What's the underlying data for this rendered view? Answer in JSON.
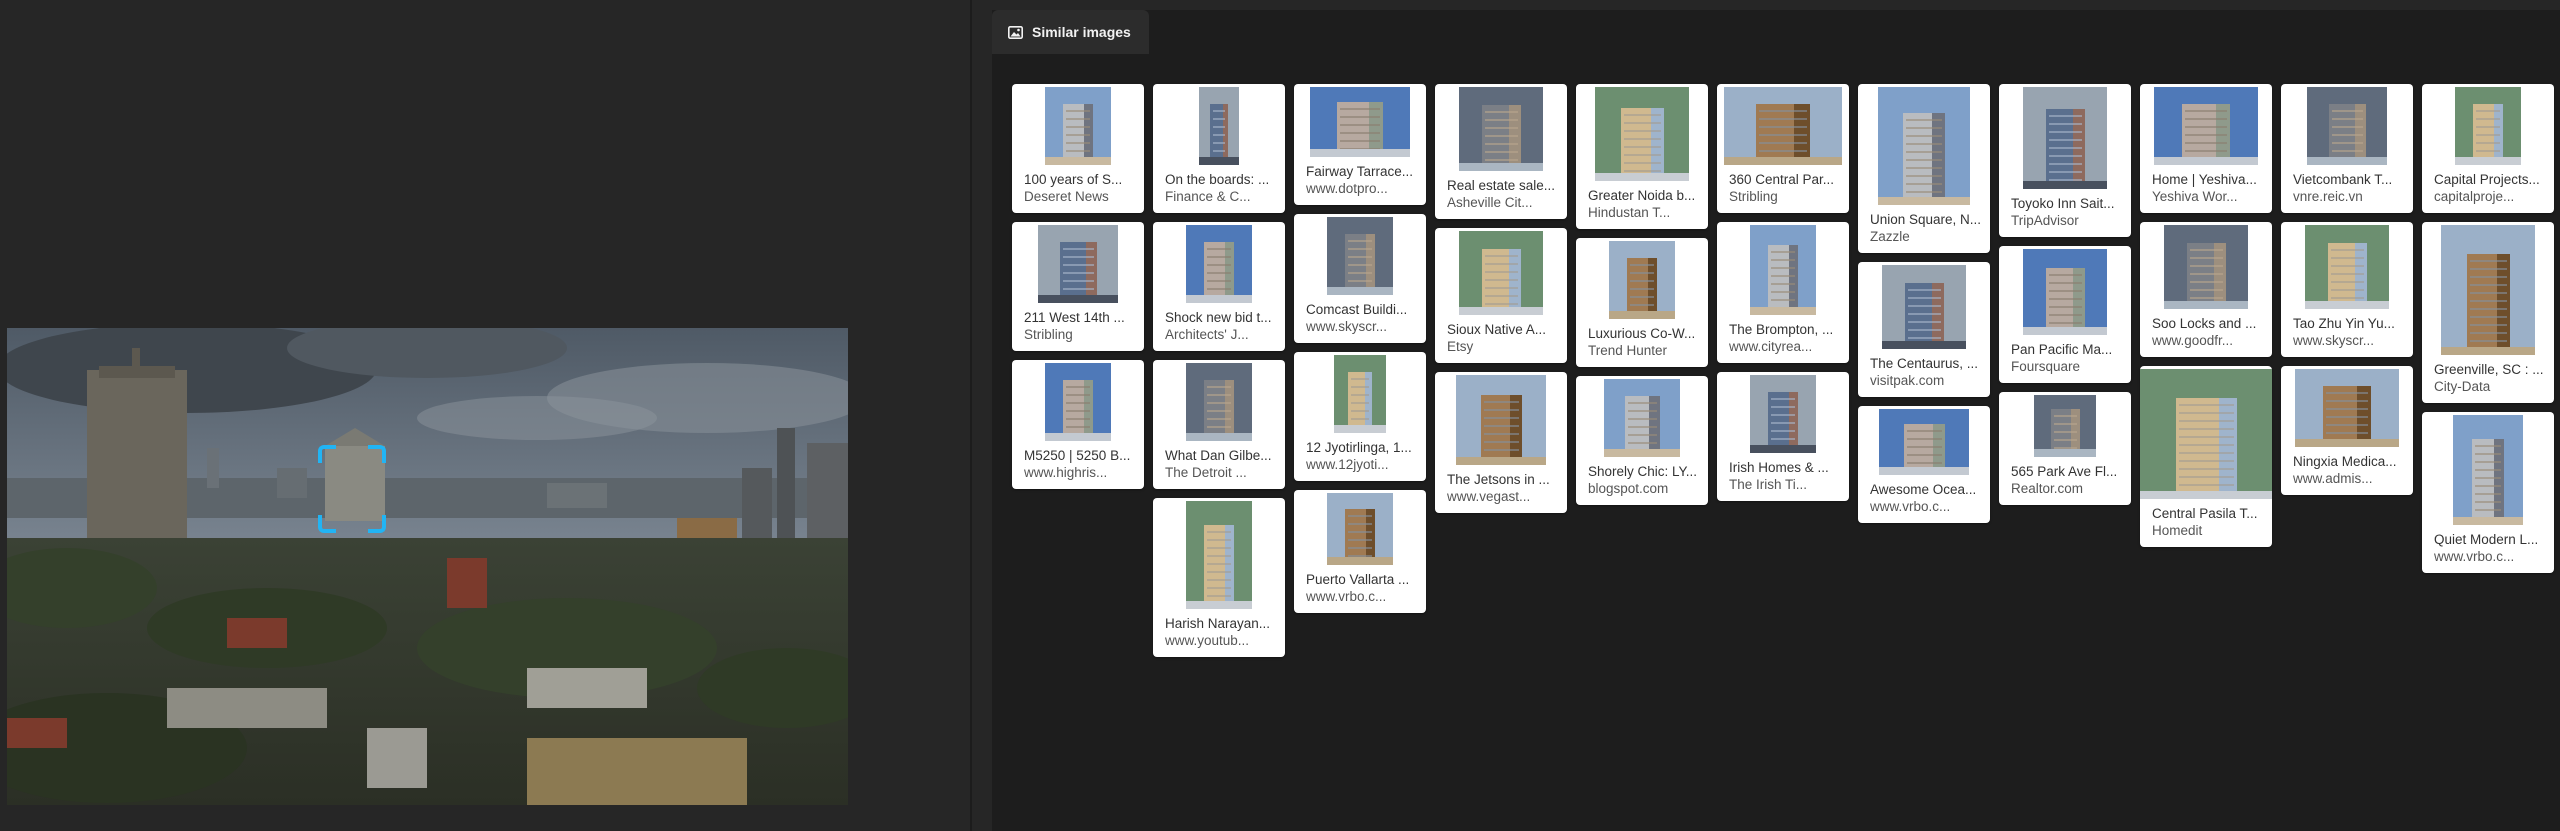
{
  "tabs": [
    {
      "label": "Similar images",
      "icon": "image-icon",
      "active": true
    }
  ],
  "colors": {
    "background": "#262626",
    "panel": "#1d1d1d",
    "crop_accent": "#21b4f4",
    "card": "#ffffff"
  },
  "results": {
    "columns": [
      [
        {
          "title": "100 years of S...",
          "source": "Deseret News"
        },
        {
          "title": "211 West 14th ...",
          "source": "Stribling"
        },
        {
          "title": "M5250 | 5250 B...",
          "source": "www.highris..."
        }
      ],
      [
        {
          "title": "On the boards: ...",
          "source": "Finance & C..."
        },
        {
          "title": "Shock new bid t...",
          "source": "Architects' J..."
        },
        {
          "title": "What Dan Gilbe...",
          "source": "The Detroit ..."
        },
        {
          "title": "Harish Narayan...",
          "source": "www.youtub..."
        }
      ],
      [
        {
          "title": "Fairway Tarrace...",
          "source": "www.dotpro..."
        },
        {
          "title": "Comcast Buildi...",
          "source": "www.skyscr..."
        },
        {
          "title": "12 Jyotirlinga, 1...",
          "source": "www.12jyoti..."
        },
        {
          "title": "Puerto Vallarta ...",
          "source": "www.vrbo.c..."
        }
      ],
      [
        {
          "title": "Real estate sale...",
          "source": "Asheville Cit..."
        },
        {
          "title": "Sioux Native A...",
          "source": "Etsy"
        },
        {
          "title": "The Jetsons in ...",
          "source": "www.vegast..."
        }
      ],
      [
        {
          "title": "Greater Noida b...",
          "source": "Hindustan T..."
        },
        {
          "title": "Luxurious Co-W...",
          "source": "Trend Hunter"
        },
        {
          "title": "Shorely Chic: LY...",
          "source": "blogspot.com"
        }
      ],
      [
        {
          "title": "360 Central Par...",
          "source": "Stribling"
        },
        {
          "title": "The Brompton, ...",
          "source": "www.cityrea..."
        },
        {
          "title": "Irish Homes & ...",
          "source": "The Irish Ti..."
        }
      ],
      [
        {
          "title": "Union Square, N...",
          "source": "Zazzle"
        },
        {
          "title": "The Centaurus, ...",
          "source": "visitpak.com"
        },
        {
          "title": "Awesome Ocea...",
          "source": "www.vrbo.c..."
        }
      ],
      [
        {
          "title": "Toyoko Inn Sait...",
          "source": "TripAdvisor"
        },
        {
          "title": "Pan Pacific Ma...",
          "source": "Foursquare"
        },
        {
          "title": "565 Park Ave Fl...",
          "source": "Realtor.com"
        }
      ],
      [
        {
          "title": "Home | Yeshiva...",
          "source": "Yeshiva Wor..."
        },
        {
          "title": "Soo Locks and ...",
          "source": "www.goodfr..."
        },
        {
          "title": "Central Pasila T...",
          "source": "Homedit"
        }
      ],
      [
        {
          "title": "Vietcombank T...",
          "source": "vnre.reic.vn"
        },
        {
          "title": "Tao Zhu Yin Yu...",
          "source": "www.skyscr..."
        },
        {
          "title": "Ningxia Medica...",
          "source": "www.admis..."
        }
      ],
      [
        {
          "title": "Capital Projects...",
          "source": "capitalproje..."
        },
        {
          "title": "Greenville, SC : ...",
          "source": "City-Data"
        },
        {
          "title": "Quiet Modern L...",
          "source": "www.vrbo.c..."
        }
      ]
    ]
  }
}
